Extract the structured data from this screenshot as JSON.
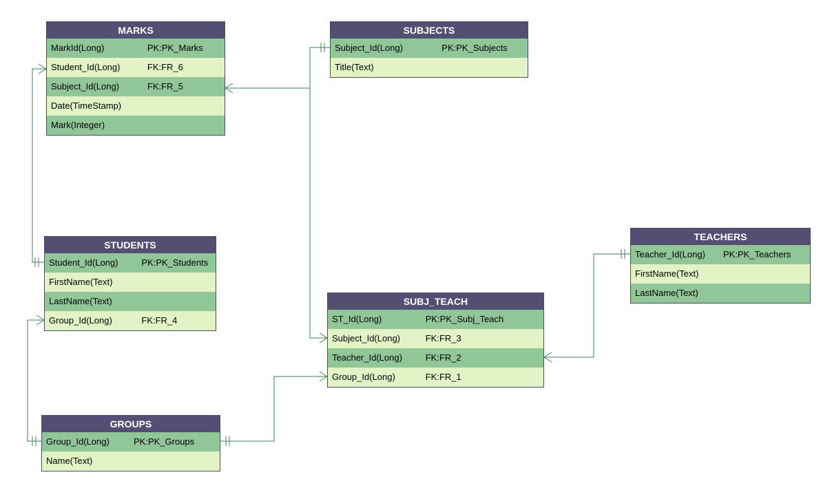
{
  "entities": {
    "marks": {
      "title": "MARKS",
      "rows": [
        {
          "name": "MarkId(Long)",
          "key": "PK:PK_Marks"
        },
        {
          "name": "Student_Id(Long)",
          "key": "FK:FR_6"
        },
        {
          "name": "Subject_Id(Long)",
          "key": "FK:FR_5"
        },
        {
          "name": "Date(TimeStamp)",
          "key": ""
        },
        {
          "name": "Mark(Integer)",
          "key": ""
        }
      ]
    },
    "subjects": {
      "title": "SUBJECTS",
      "rows": [
        {
          "name": "Subject_Id(Long)",
          "key": "PK:PK_Subjects"
        },
        {
          "name": "Title(Text)",
          "key": ""
        }
      ]
    },
    "students": {
      "title": "STUDENTS",
      "rows": [
        {
          "name": "Student_Id(Long)",
          "key": "PK:PK_Students"
        },
        {
          "name": "FirstName(Text)",
          "key": ""
        },
        {
          "name": "LastName(Text)",
          "key": ""
        },
        {
          "name": "Group_Id(Long)",
          "key": "FK:FR_4"
        }
      ]
    },
    "subj_teach": {
      "title": "SUBJ_TEACH",
      "rows": [
        {
          "name": "ST_Id(Long)",
          "key": "PK:PK_Subj_Teach"
        },
        {
          "name": "Subject_Id(Long)",
          "key": "FK:FR_3"
        },
        {
          "name": "Teacher_Id(Long)",
          "key": "FK:FR_2"
        },
        {
          "name": "Group_Id(Long)",
          "key": "FK:FR_1"
        }
      ]
    },
    "teachers": {
      "title": "TEACHERS",
      "rows": [
        {
          "name": "Teacher_Id(Long)",
          "key": "PK:PK_Teachers"
        },
        {
          "name": "FirstName(Text)",
          "key": ""
        },
        {
          "name": "LastName(Text)",
          "key": ""
        }
      ]
    },
    "groups": {
      "title": "GROUPS",
      "rows": [
        {
          "name": "Group_Id(Long)",
          "key": "PK:PK_Groups"
        },
        {
          "name": "Name(Text)",
          "key": ""
        }
      ]
    }
  }
}
